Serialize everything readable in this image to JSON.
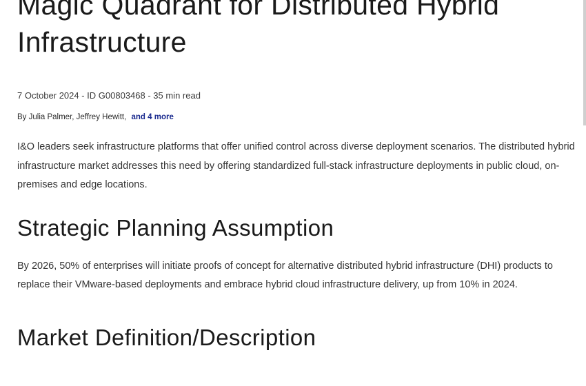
{
  "article": {
    "title": "Magic Quadrant for Distributed Hybrid Infrastructure",
    "meta": "7 October 2024 - ID G00803468 - 35 min read",
    "authors_prefix": "By Julia Palmer, Jeffrey Hewitt,",
    "more_authors": "and 4 more",
    "summary": "I&O leaders seek infrastructure platforms that offer unified control across diverse deployment scenarios. The distributed hybrid infrastructure market addresses this need by offering standardized full-stack infrastructure deployments in public cloud, on-premises and edge locations.",
    "sections": [
      {
        "heading": "Strategic Planning Assumption",
        "body": "By 2026, 50% of enterprises will initiate proofs of concept for alternative distributed hybrid infrastructure (DHI) products to replace their VMware-based deployments and embrace hybrid cloud infrastructure delivery, up from 10% in 2024."
      },
      {
        "heading": "Market Definition/Description"
      }
    ]
  },
  "colors": {
    "link": "#1b2b8f",
    "text": "#1a1a1a",
    "body_text": "#333333"
  }
}
